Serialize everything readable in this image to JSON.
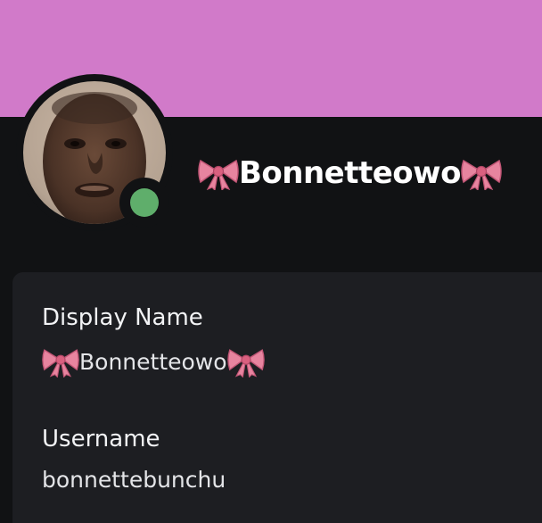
{
  "profile": {
    "header_name": "Bonnetteowo",
    "name_decoration_icon": "ribbon-bow-emoji",
    "status": "online",
    "status_color": "#5fae6b",
    "banner_color": "#d17ac9"
  },
  "card": {
    "display_name_label": "Display Name",
    "display_name_value": "Bonnetteowo",
    "username_label": "Username",
    "username_value": "bonnettebunchu"
  },
  "colors": {
    "background": "#111214",
    "card": "#1d1e22",
    "bow_pink": "#e7849f"
  }
}
